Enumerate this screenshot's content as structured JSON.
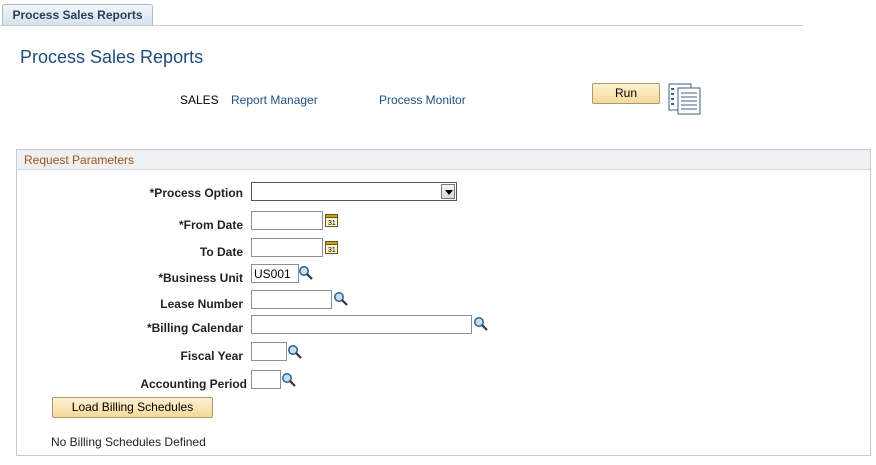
{
  "tab": {
    "label": "Process Sales Reports"
  },
  "page": {
    "title": "Process Sales Reports"
  },
  "header": {
    "run_control": "SALES",
    "report_manager": "Report Manager",
    "process_monitor": "Process Monitor",
    "run_label": "Run"
  },
  "group": {
    "title": "Request Parameters",
    "fields": {
      "process_option": {
        "label": "*Process Option",
        "value": ""
      },
      "from_date": {
        "label": "*From Date",
        "value": ""
      },
      "to_date": {
        "label": "To Date",
        "value": ""
      },
      "business_unit": {
        "label": "*Business Unit",
        "value": "US001"
      },
      "lease_number": {
        "label": "Lease Number",
        "value": ""
      },
      "billing_calendar": {
        "label": "*Billing Calendar",
        "value": ""
      },
      "fiscal_year": {
        "label": "Fiscal Year",
        "value": ""
      },
      "accounting_period": {
        "label": "Accounting Period",
        "value": ""
      }
    },
    "load_button": "Load Billing Schedules",
    "note": "No Billing Schedules Defined"
  },
  "icons": {
    "calendar": "calendar-icon",
    "lookup": "magnifier-icon",
    "process_list": "process-list-icon"
  }
}
